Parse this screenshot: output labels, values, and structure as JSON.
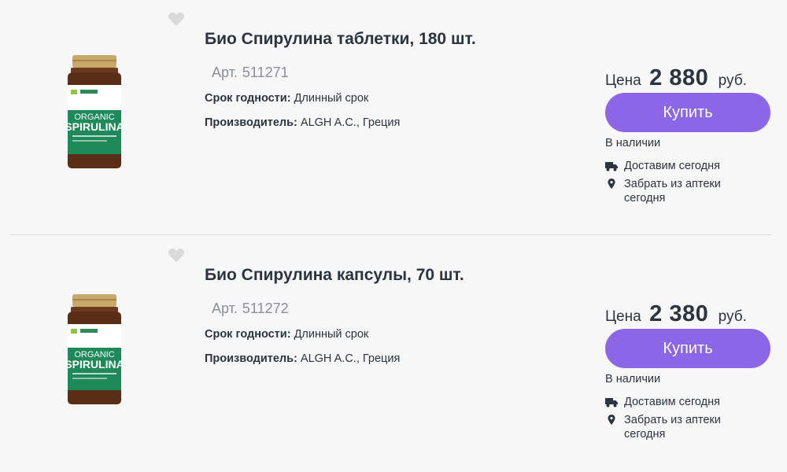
{
  "colors": {
    "accent": "#8b66e6",
    "text": "#2b3440",
    "muted": "#8a8f99",
    "background": "#f7f7f7"
  },
  "products": [
    {
      "title": "Био Спирулина таблетки, 180 шт.",
      "sku_label": "Арт.",
      "sku": "511271",
      "shelf_life_label": "Срок годности:",
      "shelf_life": "Длинный срок",
      "maker_label": "Производитель:",
      "maker": "ALGH A.C., Греция",
      "price_label": "Цена",
      "price": "2 880",
      "currency": "руб.",
      "buy_label": "Купить",
      "stock": "В наличии",
      "delivery": "Доставим сегодня",
      "pickup": "Забрать из аптеки сегодня",
      "image_text": {
        "top": "ORGANIC",
        "main": "SPIRULINA"
      },
      "icons": {
        "favorite": "heart-icon",
        "delivery": "truck-icon",
        "pickup": "map-pin-icon"
      }
    },
    {
      "title": "Био Спирулина капсулы, 70 шт.",
      "sku_label": "Арт.",
      "sku": "511272",
      "shelf_life_label": "Срок годности:",
      "shelf_life": "Длинный срок",
      "maker_label": "Производитель:",
      "maker": "ALGH A.C., Греция",
      "price_label": "Цена",
      "price": "2 380",
      "currency": "руб.",
      "buy_label": "Купить",
      "stock": "В наличии",
      "delivery": "Доставим сегодня",
      "pickup": "Забрать из аптеки сегодня",
      "image_text": {
        "top": "ORGANIC",
        "main": "SPIRULINA"
      },
      "icons": {
        "favorite": "heart-icon",
        "delivery": "truck-icon",
        "pickup": "map-pin-icon"
      }
    }
  ]
}
